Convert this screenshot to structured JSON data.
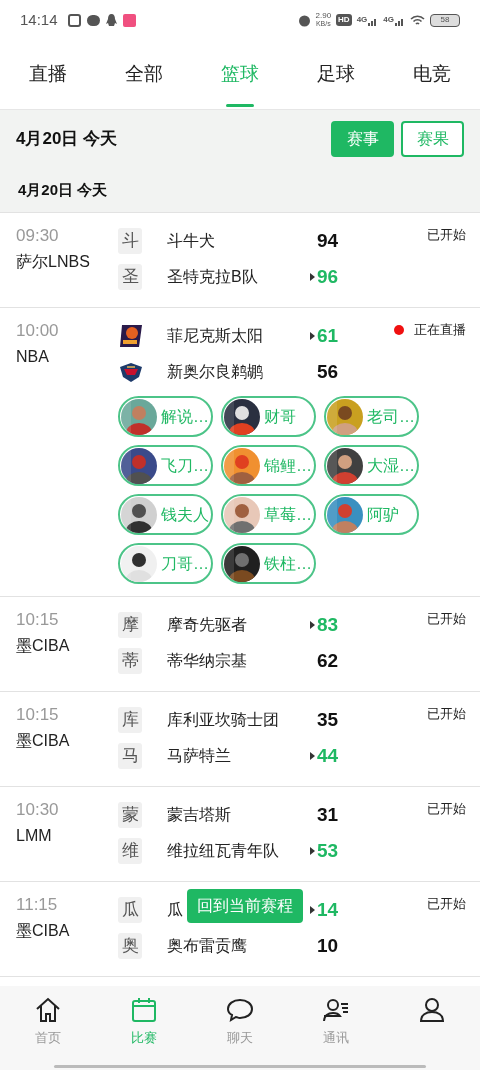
{
  "status_bar": {
    "time": "14:14",
    "speed": "2.90",
    "speed_unit": "KB/s",
    "hd": "HD",
    "networks": [
      "4G",
      "4G"
    ],
    "battery": "58"
  },
  "tabs": [
    {
      "label": "直播",
      "selected": false
    },
    {
      "label": "全部",
      "selected": false
    },
    {
      "label": "篮球",
      "selected": true
    },
    {
      "label": "足球",
      "selected": false
    },
    {
      "label": "电竞",
      "selected": false
    }
  ],
  "date_bar": {
    "date": "4月20日 今天",
    "buttons": [
      {
        "label": "赛事",
        "selected": true
      },
      {
        "label": "赛果",
        "selected": false
      }
    ]
  },
  "section_header": "4月20日 今天",
  "matches": [
    {
      "time": "09:30",
      "league": "萨尔LNBS",
      "status": "已开始",
      "live": false,
      "teams": [
        {
          "kind": "letter",
          "badge": "斗",
          "name": "斗牛犬",
          "score": "94",
          "leading": false
        },
        {
          "kind": "letter",
          "badge": "圣",
          "name": "圣特克拉B队",
          "score": "96",
          "leading": true
        }
      ]
    },
    {
      "time": "10:00",
      "league": "NBA",
      "status": "正在直播",
      "live": true,
      "teams": [
        {
          "kind": "sun",
          "name": "菲尼克斯太阳",
          "score": "61",
          "leading": true
        },
        {
          "kind": "bird",
          "name": "新奥尔良鹈鹕",
          "score": "56",
          "leading": false
        }
      ],
      "commentators": [
        {
          "name": "解说…"
        },
        {
          "name": "财哥"
        },
        {
          "name": "老司…"
        },
        {
          "name": "飞刀…"
        },
        {
          "name": "锦鲤…"
        },
        {
          "name": "大湿…"
        },
        {
          "name": "钱夫人"
        },
        {
          "name": "草莓…"
        },
        {
          "name": "阿驴"
        },
        {
          "name": "刀哥…"
        },
        {
          "name": "铁柱…"
        }
      ]
    },
    {
      "time": "10:15",
      "league": "墨CIBA",
      "status": "已开始",
      "live": false,
      "teams": [
        {
          "kind": "letter",
          "badge": "摩",
          "name": "摩奇先驱者",
          "score": "83",
          "leading": true
        },
        {
          "kind": "letter",
          "badge": "蒂",
          "name": "蒂华纳宗基",
          "score": "62",
          "leading": false
        }
      ]
    },
    {
      "time": "10:15",
      "league": "墨CIBA",
      "status": "已开始",
      "live": false,
      "teams": [
        {
          "kind": "letter",
          "badge": "库",
          "name": "库利亚坎骑士团",
          "score": "35",
          "leading": false
        },
        {
          "kind": "letter",
          "badge": "马",
          "name": "马萨特兰",
          "score": "44",
          "leading": true
        }
      ]
    },
    {
      "time": "10:30",
      "league": "LMM",
      "status": "已开始",
      "live": false,
      "teams": [
        {
          "kind": "letter",
          "badge": "蒙",
          "name": "蒙吉塔斯",
          "score": "31",
          "leading": false
        },
        {
          "kind": "letter",
          "badge": "维",
          "name": "维拉纽瓦青年队",
          "score": "53",
          "leading": true
        }
      ]
    },
    {
      "time": "11:15",
      "league": "墨CIBA",
      "status": "已开始",
      "live": false,
      "teams": [
        {
          "kind": "letter",
          "badge": "瓜",
          "name": "瓜",
          "score": "14",
          "leading": true
        },
        {
          "kind": "letter",
          "badge": "奥",
          "name": "奥布雷贡鹰",
          "score": "10",
          "leading": false
        }
      ]
    }
  ],
  "floating_button": "回到当前赛程",
  "bottom_nav": [
    {
      "kind": "home",
      "label": "首页",
      "selected": false
    },
    {
      "kind": "calendar",
      "label": "比赛",
      "selected": true
    },
    {
      "kind": "chat",
      "label": "聊天",
      "selected": false
    },
    {
      "kind": "contacts",
      "label": "通讯",
      "selected": false
    },
    {
      "kind": "user",
      "selected": false
    }
  ]
}
